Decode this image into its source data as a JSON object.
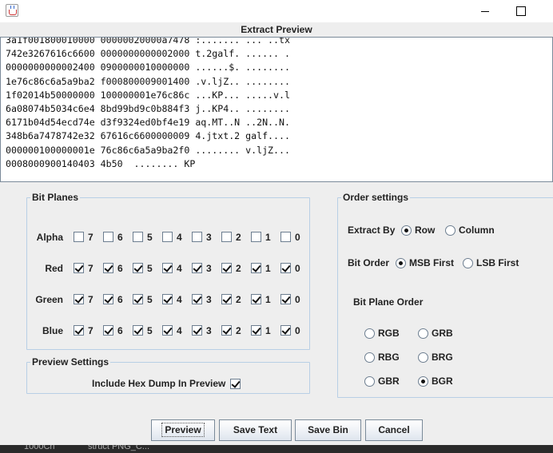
{
  "dialog": {
    "title": "Extract Preview"
  },
  "preview": {
    "lines": [
      "3a1f001800010000 00000020000a7478 :....... ... ..tx",
      "742e3267616c6600 0000000000002000 t.2galf. ...... .",
      "0000000000002400 0900000010000000 ......$. ........",
      "1e76c86c6a5a9ba2 f000800009001400 .v.ljZ.. ........",
      "1f02014b50000000 100000001e76c86c ...KP... .....v.l",
      "6a08074b5034c6e4 8bd99bd9c0b884f3 j..KP4.. ........",
      "6171b04d54ecd74e d3f9324ed0bf4e19 aq.MT..N ..2N..N.",
      "348b6a7478742e32 67616c6600000009 4.jtxt.2 galf....",
      "000000100000001e 76c86c6a5a9ba2f0 ........ v.ljZ...",
      "0008000900140403 4b50  ........ KP"
    ]
  },
  "bit_planes": {
    "title": "Bit Planes",
    "rows": [
      {
        "label": "Alpha",
        "bits": [
          {
            "n": "7",
            "checked": false
          },
          {
            "n": "6",
            "checked": false
          },
          {
            "n": "5",
            "checked": false
          },
          {
            "n": "4",
            "checked": false
          },
          {
            "n": "3",
            "checked": false
          },
          {
            "n": "2",
            "checked": false
          },
          {
            "n": "1",
            "checked": false
          },
          {
            "n": "0",
            "checked": false
          }
        ]
      },
      {
        "label": "Red",
        "bits": [
          {
            "n": "7",
            "checked": true
          },
          {
            "n": "6",
            "checked": true
          },
          {
            "n": "5",
            "checked": true
          },
          {
            "n": "4",
            "checked": true
          },
          {
            "n": "3",
            "checked": true
          },
          {
            "n": "2",
            "checked": true
          },
          {
            "n": "1",
            "checked": true
          },
          {
            "n": "0",
            "checked": true
          }
        ]
      },
      {
        "label": "Green",
        "bits": [
          {
            "n": "7",
            "checked": true
          },
          {
            "n": "6",
            "checked": true
          },
          {
            "n": "5",
            "checked": true
          },
          {
            "n": "4",
            "checked": true
          },
          {
            "n": "3",
            "checked": true
          },
          {
            "n": "2",
            "checked": true
          },
          {
            "n": "1",
            "checked": true
          },
          {
            "n": "0",
            "checked": true
          }
        ]
      },
      {
        "label": "Blue",
        "bits": [
          {
            "n": "7",
            "checked": true
          },
          {
            "n": "6",
            "checked": true
          },
          {
            "n": "5",
            "checked": true
          },
          {
            "n": "4",
            "checked": true
          },
          {
            "n": "3",
            "checked": true
          },
          {
            "n": "2",
            "checked": true
          },
          {
            "n": "1",
            "checked": true
          },
          {
            "n": "0",
            "checked": true
          }
        ]
      }
    ]
  },
  "preview_settings": {
    "title": "Preview Settings",
    "hex_dump_label": "Include Hex Dump In Preview",
    "hex_dump_checked": true
  },
  "order_settings": {
    "title": "Order settings",
    "extract_by": {
      "label": "Extract By",
      "options": [
        "Row",
        "Column"
      ],
      "selected": "Row"
    },
    "bit_order": {
      "label": "Bit Order",
      "options": [
        "MSB First",
        "LSB First"
      ],
      "selected": "MSB First"
    },
    "plane_order": {
      "label": "Bit Plane Order",
      "options": [
        "RGB",
        "GRB",
        "RBG",
        "BRG",
        "GBR",
        "BGR"
      ],
      "selected": "BGR"
    }
  },
  "buttons": {
    "preview": "Preview",
    "save_text": "Save Text",
    "save_bin": "Save Bin",
    "cancel": "Cancel"
  },
  "taskbar": {
    "left_text": "1000Ch",
    "right_text": "struct PNG_C..."
  },
  "icons": {
    "app": "java-icon",
    "minimize": "minimize-icon",
    "maximize": "maximize-icon"
  }
}
